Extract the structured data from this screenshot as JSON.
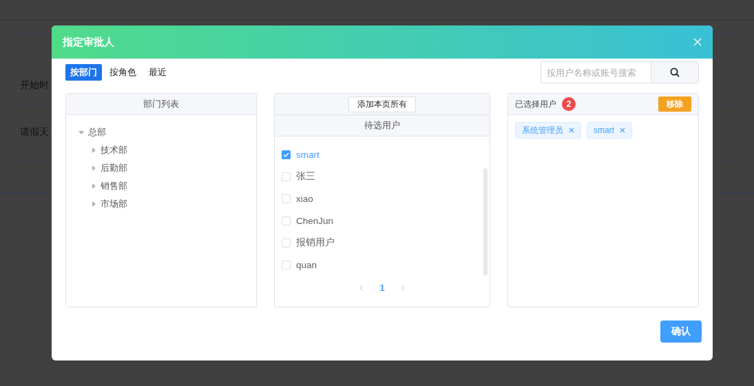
{
  "background_page": {
    "rows": [
      {
        "label": "开始时"
      },
      {
        "label": "请假天"
      }
    ]
  },
  "dialog": {
    "title": "指定审批人",
    "tabs": [
      {
        "label": "按部门",
        "selected": true
      },
      {
        "label": "按角色",
        "selected": false
      },
      {
        "label": "最近",
        "selected": false
      }
    ],
    "search": {
      "placeholder": "按用户名称或账号搜索"
    },
    "department_panel": {
      "title": "部门列表",
      "tree": [
        {
          "label": "总部",
          "expanded": true,
          "children": [
            {
              "label": "技术部",
              "expanded": false
            },
            {
              "label": "后勤部",
              "expanded": false
            },
            {
              "label": "销售部",
              "expanded": false
            },
            {
              "label": "市场部",
              "expanded": false
            }
          ]
        }
      ]
    },
    "candidate_panel": {
      "add_all_button": "添加本页所有",
      "title": "待选用户",
      "users": [
        {
          "name": "smart",
          "checked": true
        },
        {
          "name": "张三",
          "checked": false
        },
        {
          "name": "xiao",
          "checked": false
        },
        {
          "name": "ChenJun",
          "checked": false
        },
        {
          "name": "报销用户",
          "checked": false
        },
        {
          "name": "quan",
          "checked": false
        }
      ],
      "pagination": {
        "pages": [
          {
            "label": "1",
            "selected": true
          }
        ]
      }
    },
    "selected_panel": {
      "title": "已选择用户",
      "count": "2",
      "remove_button": "移除",
      "tags": [
        "系统管理员",
        "smart"
      ]
    },
    "confirm_button": "确认"
  }
}
